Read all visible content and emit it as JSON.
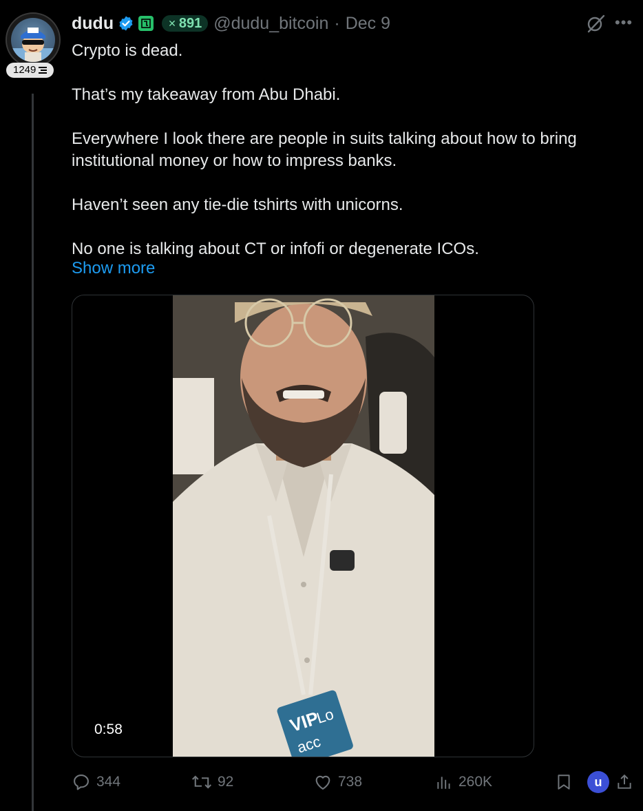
{
  "tweet": {
    "display_name": "dudu",
    "x_score": "891",
    "handle": "@dudu_bitcoin",
    "separator": "·",
    "date": "Dec 9",
    "author_score": "1249",
    "body": [
      "Crypto is dead.",
      "That’s my takeaway from Abu Dhabi.",
      "Everywhere I look there are people in suits talking about how to bring institutional money or how to impress banks.",
      "Haven’t seen any tie-die tshirts with unicorns.",
      "No one is talking about CT or infofi or degenerate ICOs."
    ],
    "show_more": "Show more",
    "video": {
      "duration": "0:58",
      "lanyard_text": "VIP",
      "lanyard_text_2": "Lo",
      "lanyard_text_3": "acc"
    },
    "stats": {
      "replies": "344",
      "reposts": "92",
      "likes": "738",
      "views": "260K"
    },
    "current_user_initial": "u"
  },
  "colors": {
    "background": "#000000",
    "text": "#e7e9ea",
    "muted": "#71767b",
    "link": "#1d9bf0",
    "verified": "#1d9bf0"
  },
  "icons": [
    "avatar",
    "verified-icon",
    "green-tag-icon",
    "grok-icon",
    "more-icon",
    "reply-icon",
    "retweet-icon",
    "like-icon",
    "views-icon",
    "bookmark-icon",
    "share-icon"
  ]
}
